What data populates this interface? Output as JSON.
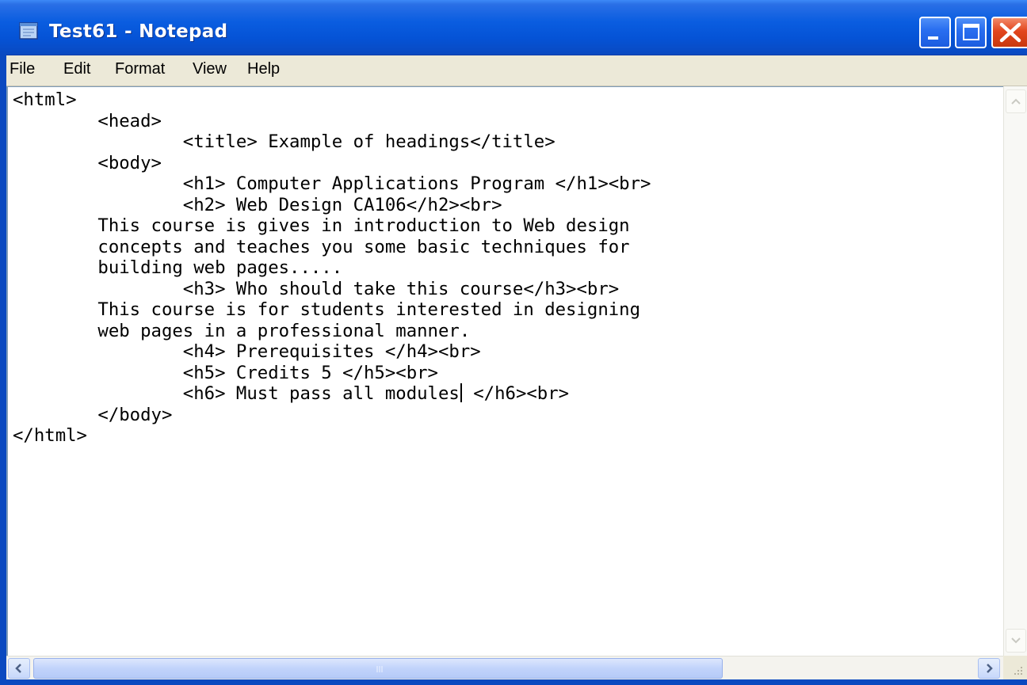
{
  "window": {
    "title": "Test61 - Notepad",
    "colors": {
      "titlebar": "#0a5de0",
      "close_button": "#e2461e",
      "menubar": "#ece9d8"
    }
  },
  "menu": {
    "items": [
      {
        "label": "File"
      },
      {
        "label": "Edit"
      },
      {
        "label": "Format"
      },
      {
        "label": "View"
      },
      {
        "label": "Help"
      }
    ]
  },
  "editor": {
    "lines": [
      "<html>",
      "\t<head>",
      "\t\t<title> Example of headings</title>",
      "\t<body>",
      "\t\t<h1> Computer Applications Program </h1><br>",
      "\t\t<h2> Web Design CA106</h2><br>",
      "\tThis course is gives in introduction to Web design",
      "\tconcepts and teaches you some basic techniques for",
      "\tbuilding web pages.....",
      "\t\t<h3> Who should take this course</h3><br>",
      "\tThis course is for students interested in designing",
      "\tweb pages in a professional manner.",
      "\t\t<h4> Prerequisites </h4><br>",
      "\t\t<h5> Credits 5 </h5><br>",
      "\t\t<h6> Must pass all modules",
      " </h6><br>",
      "\t</body>",
      "</html>"
    ]
  },
  "icons": {
    "app": "notepad-icon",
    "minimize": "minimize-icon",
    "maximize": "maximize-icon",
    "close": "close-icon",
    "scroll_up": "arrow-up-icon",
    "scroll_down": "arrow-down-icon",
    "scroll_left": "arrow-left-icon",
    "scroll_right": "arrow-right-icon"
  }
}
